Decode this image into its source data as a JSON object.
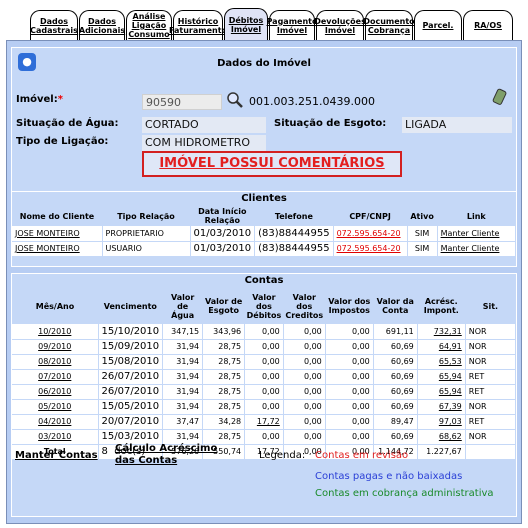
{
  "tabs": [
    {
      "label": "Dados\nCadastrais"
    },
    {
      "label": "Dados\nAdicionais"
    },
    {
      "label": "Análise\nLigação\nConsumo"
    },
    {
      "label": "Histórico\nFaturamento"
    },
    {
      "label": "Débitos\nImóvel"
    },
    {
      "label": "Pagamento\nImóvel"
    },
    {
      "label": "Devoluções\nImóvel"
    },
    {
      "label": "Documento\nCobrança"
    },
    {
      "label": "Parcel."
    },
    {
      "label": "RA/OS"
    }
  ],
  "imovel": {
    "title": "Dados do Imóvel",
    "imovel_label": "Imóvel:",
    "required_mark": "*",
    "imovel_value": "90590",
    "inscricao": "001.003.251.0439.000",
    "sit_agua_label": "Situação de Água:",
    "sit_agua_value": "CORTADO",
    "sit_esgoto_label": "Situação de Esgoto:",
    "sit_esgoto_value": "LIGADA",
    "tipo_lig_label": "Tipo de Ligação:",
    "tipo_lig_value": "COM HIDROMETRO",
    "warning": "IMÓVEL POSSUI COMENTÁRIOS"
  },
  "clientes": {
    "title": "Clientes",
    "headers": [
      "Nome do Cliente",
      "Tipo Relação",
      "Data Início Relação",
      "Telefone",
      "CPF/CNPJ",
      "Ativo",
      "Link"
    ],
    "rows": [
      [
        "JOSE MONTEIRO",
        "PROPRIETARIO",
        "01/03/2010",
        "(83)88444955",
        "072.595.654-20",
        "SIM",
        "Manter Cliente"
      ],
      [
        "JOSE MONTEIRO",
        "USUARIO",
        "01/03/2010",
        "(83)88444955",
        "072.595.654-20",
        "SIM",
        "Manter Cliente"
      ]
    ]
  },
  "contas": {
    "title": "Contas",
    "headers": [
      "Mês/Ano",
      "Vencimento",
      "Valor de Água",
      "Valor de Esgoto",
      "Valor dos Débitos",
      "Valor dos Creditos",
      "Valor dos Impostos",
      "Valor da Conta",
      "Acrésc. Impont.",
      "Sit."
    ],
    "rows": [
      [
        "10/2010",
        "15/10/2010",
        "347,15",
        "343,96",
        "0,00",
        "0,00",
        "0,00",
        "691,11",
        "732,31",
        "NOR"
      ],
      [
        "09/2010",
        "15/09/2010",
        "31,94",
        "28,75",
        "0,00",
        "0,00",
        "0,00",
        "60,69",
        "64,91",
        "NOR"
      ],
      [
        "08/2010",
        "15/08/2010",
        "31,94",
        "28,75",
        "0,00",
        "0,00",
        "0,00",
        "60,69",
        "65,53",
        "NOR"
      ],
      [
        "07/2010",
        "26/07/2010",
        "31,94",
        "28,75",
        "0,00",
        "0,00",
        "0,00",
        "60,69",
        "65,94",
        "RET"
      ],
      [
        "06/2010",
        "26/07/2010",
        "31,94",
        "28,75",
        "0,00",
        "0,00",
        "0,00",
        "60,69",
        "65,94",
        "RET"
      ],
      [
        "05/2010",
        "15/05/2010",
        "31,94",
        "28,75",
        "0,00",
        "0,00",
        "0,00",
        "60,69",
        "67,39",
        "NOR"
      ],
      [
        "04/2010",
        "20/07/2010",
        "37,47",
        "34,28",
        "17,72",
        "0,00",
        "0,00",
        "89,47",
        "97,03",
        "RET"
      ],
      [
        "03/2010",
        "15/03/2010",
        "31,94",
        "28,75",
        "0,00",
        "0,00",
        "0,00",
        "60,69",
        "68,62",
        "NOR"
      ]
    ],
    "total_label": "Total",
    "total_docs": "8",
    "total_docs_suffix": "doc(s)",
    "total_agua": "576,26",
    "total_esgoto": "550,74",
    "total_debitos": "17,72",
    "total_creditos": "0,00",
    "total_impostos": "0,00",
    "total_conta": "1.144,72",
    "total_acresc": "1.227,67"
  },
  "footer": {
    "manter_contas": "Manter Contas",
    "calculo": "Cálculo Acréscimo das Contas",
    "legenda_label": "Legenda:",
    "legenda_revisao": "Contas em revisão",
    "legenda_pagas": "Contas pagas e não baixadas",
    "legenda_cobranca": "Contas em cobrança administrativa"
  },
  "colors": {
    "panel": "#b7cdf3",
    "warning": "#e31f1f",
    "link_red": "#e00000"
  }
}
